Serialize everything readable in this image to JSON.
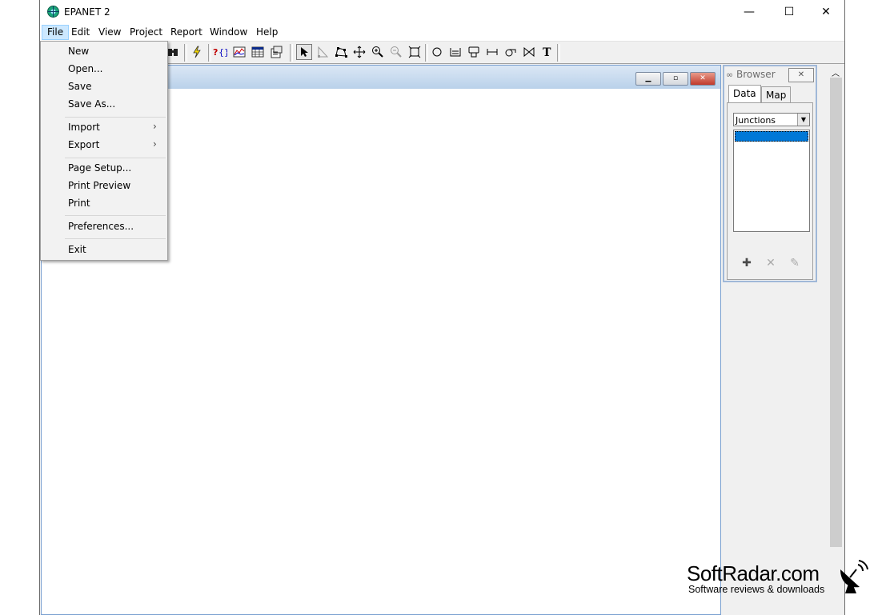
{
  "app": {
    "title": "EPANET 2"
  },
  "window_controls": {
    "minimize": "—",
    "maximize": "☐",
    "close": "✕"
  },
  "menubar": [
    "File",
    "Edit",
    "View",
    "Project",
    "Report",
    "Window",
    "Help"
  ],
  "file_menu": {
    "new": "New",
    "open": "Open...",
    "save": "Save",
    "save_as": "Save As...",
    "import": "Import",
    "export": "Export",
    "page_setup": "Page Setup...",
    "print_preview": "Print Preview",
    "print": "Print",
    "preferences": "Preferences...",
    "exit": "Exit"
  },
  "browser": {
    "title": "Browser",
    "tabs": [
      "Data",
      "Map"
    ],
    "selected_tab": "Data",
    "category": "Junctions"
  },
  "watermark": {
    "name": "SoftRadar.com",
    "tagline": "Software reviews & downloads"
  },
  "colors": {
    "selection": "#0078d7",
    "menu_highlight": "#cce8ff",
    "child_title": "#b9d1ea"
  }
}
